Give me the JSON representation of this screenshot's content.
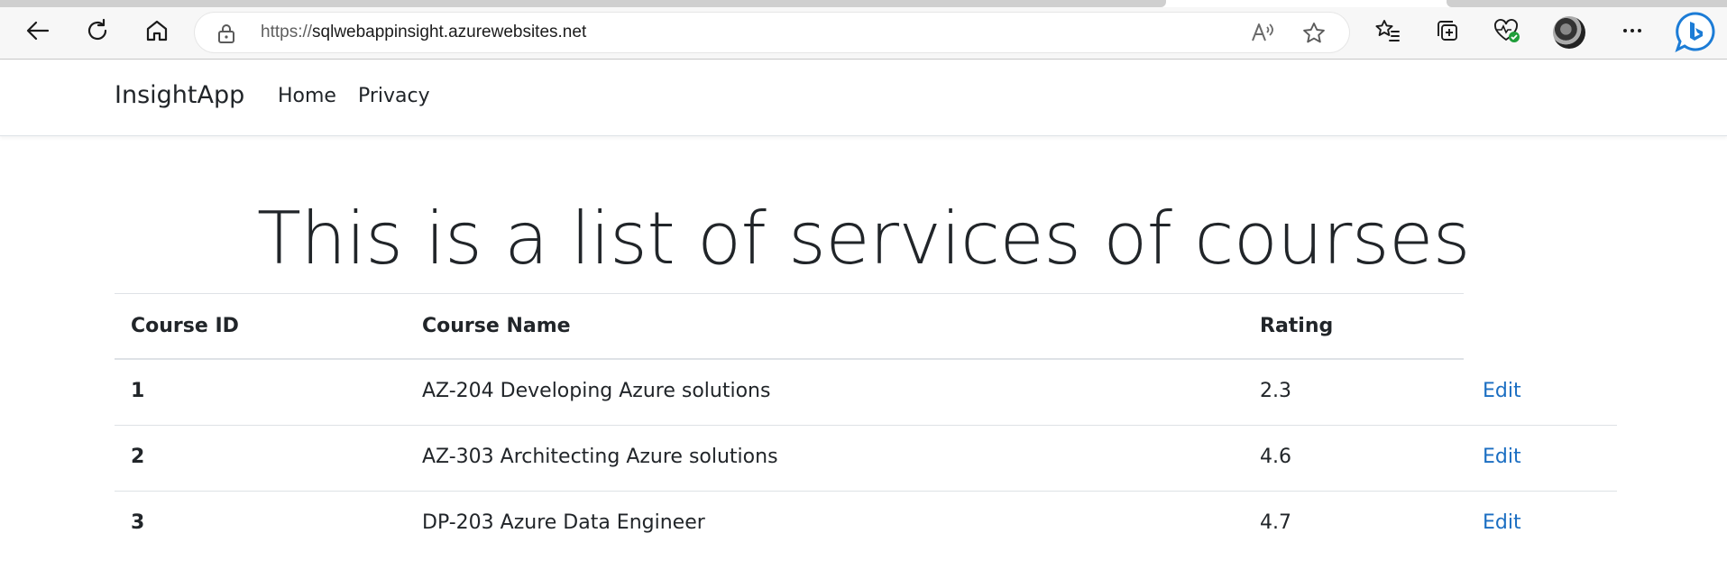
{
  "browser": {
    "url_scheme": "https://",
    "url_host": "sqlwebappinsight.azurewebsites.net",
    "icons": [
      "back-icon",
      "refresh-icon",
      "home-icon",
      "lock-icon",
      "read-aloud-icon",
      "favorite-star-icon",
      "favorites-icon",
      "collections-icon",
      "browser-essentials-icon",
      "profile-avatar",
      "more-icon",
      "bing-chat-icon"
    ]
  },
  "navbar": {
    "brand": "InsightApp",
    "links": [
      "Home",
      "Privacy"
    ]
  },
  "main": {
    "heading": "This is a list of services of courses",
    "table": {
      "headers": [
        "Course ID",
        "Course Name",
        "Rating"
      ],
      "rows": [
        {
          "id": "1",
          "name": "AZ-204 Developing Azure solutions",
          "rating": "2.3",
          "action": "Edit"
        },
        {
          "id": "2",
          "name": "AZ-303 Architecting Azure solutions",
          "rating": "4.6",
          "action": "Edit"
        },
        {
          "id": "3",
          "name": "DP-203 Azure Data Engineer",
          "rating": "4.7",
          "action": "Edit"
        }
      ]
    }
  },
  "colors": {
    "link": "#1b6ec2",
    "text": "#212529",
    "border": "#dee2e6",
    "bing": "#1c7cd6"
  }
}
